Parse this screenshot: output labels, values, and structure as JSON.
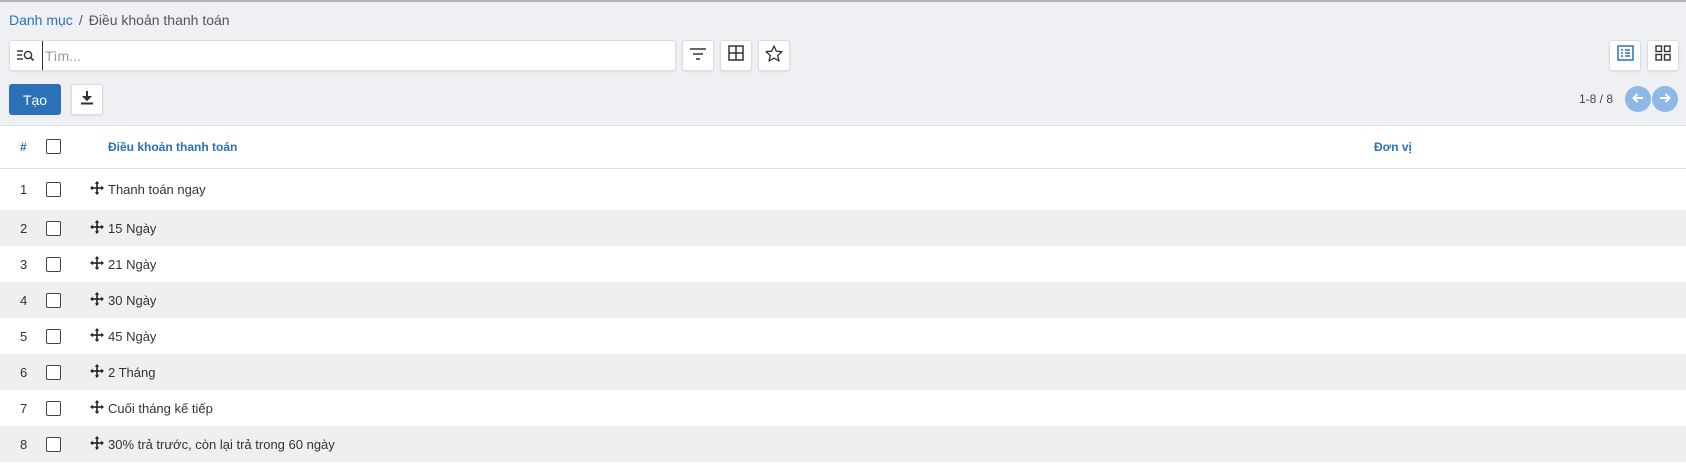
{
  "breadcrumb": {
    "parent": "Danh mục",
    "separator": "/",
    "current": "Điều khoản thanh toán"
  },
  "search": {
    "placeholder": "Tìm...",
    "value": ""
  },
  "toolbar": {
    "create_label": "Tạo",
    "icons": [
      "filter-icon",
      "group-by-icon",
      "favorite-star-icon",
      "list-view-icon",
      "kanban-view-icon",
      "download-icon"
    ]
  },
  "pager": {
    "text": "1-8 / 8"
  },
  "table": {
    "headers": {
      "num": "#",
      "name": "Điều khoản thanh toán",
      "unit": "Đơn vị"
    },
    "rows": [
      {
        "num": "1",
        "name": "Thanh toán ngay",
        "unit": ""
      },
      {
        "num": "2",
        "name": "15 Ngày",
        "unit": ""
      },
      {
        "num": "3",
        "name": "21 Ngày",
        "unit": ""
      },
      {
        "num": "4",
        "name": "30 Ngày",
        "unit": ""
      },
      {
        "num": "5",
        "name": "45 Ngày",
        "unit": ""
      },
      {
        "num": "6",
        "name": "2 Tháng",
        "unit": ""
      },
      {
        "num": "7",
        "name": "Cuối tháng kế tiếp",
        "unit": ""
      },
      {
        "num": "8",
        "name": "30% trả trước, còn lại trả trong 60 ngày",
        "unit": ""
      }
    ]
  },
  "colors": {
    "accent": "#2b71b8",
    "pager_button": "#8eb8e8",
    "panel_bg": "#eef0f4",
    "row_alt": "#efefef"
  }
}
